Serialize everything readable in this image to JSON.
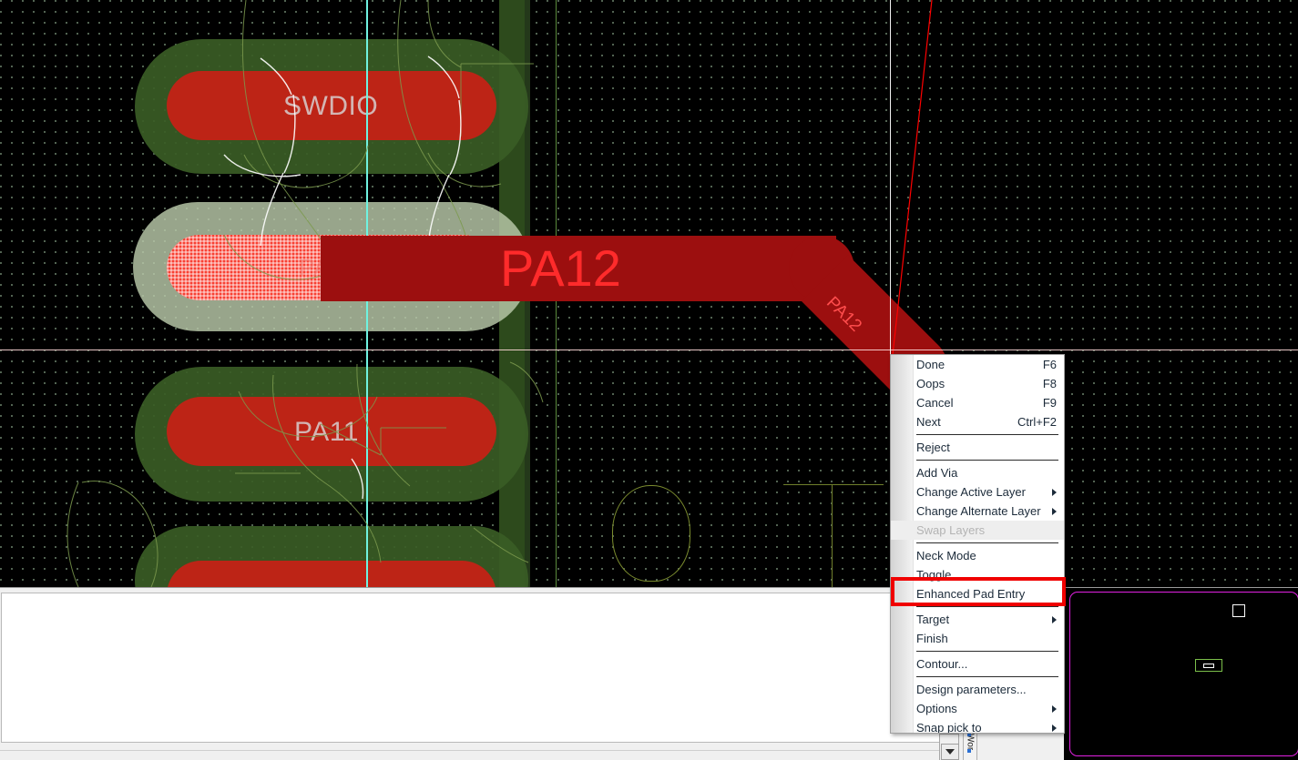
{
  "app": {
    "kind": "pcb-layout-editor",
    "colors": {
      "canvas_background": "#000000",
      "pad_copper": "#bd2416",
      "pad_copper_highlight": "#f84033",
      "soldermask_green": "#3a5c25",
      "soldermask_green_lit": "#b9c9a9",
      "trace_red": "#9c0f0f",
      "trace_label": "#ff2b2b",
      "crosshair_vertical": "#ffffff",
      "crosshair_horizontal": "#ffd9d9",
      "snap_line_cyan": "#6ff2e0",
      "silkscreen_olive": "#7a8b2e",
      "board_outline_magenta": "#e221e2",
      "annotation_red": "#f00000",
      "menu_background": "#ffffff",
      "menu_text": "#1c2b3a",
      "menu_disabled_text": "#b4b4b4"
    }
  },
  "canvas": {
    "pads": [
      {
        "name": "SWDIO",
        "label": "SWDIO",
        "state": "normal"
      },
      {
        "name": "PA12",
        "label": "PA12",
        "state": "highlighted"
      },
      {
        "name": "PA11",
        "label": "PA11",
        "state": "normal"
      },
      {
        "name": "pad-bottom",
        "label": "",
        "state": "normal"
      }
    ],
    "trace": {
      "net": "PA12",
      "label": "PA12",
      "rotated_label": "PA12"
    }
  },
  "context_menu": {
    "name": "route-context-menu",
    "items": [
      {
        "label": "Done",
        "accel": "F6",
        "type": "item",
        "enabled": true,
        "submenu": false
      },
      {
        "label": "Oops",
        "accel": "F8",
        "type": "item",
        "enabled": true,
        "submenu": false
      },
      {
        "label": "Cancel",
        "accel": "F9",
        "type": "item",
        "enabled": true,
        "submenu": false
      },
      {
        "label": "Next",
        "accel": "Ctrl+F2",
        "type": "item",
        "enabled": true,
        "submenu": false
      },
      {
        "label": "",
        "accel": "",
        "type": "separator",
        "enabled": true,
        "submenu": false
      },
      {
        "label": "Reject",
        "accel": "",
        "type": "item",
        "enabled": true,
        "submenu": false
      },
      {
        "label": "",
        "accel": "",
        "type": "separator",
        "enabled": true,
        "submenu": false
      },
      {
        "label": "Add Via",
        "accel": "",
        "type": "item",
        "enabled": true,
        "submenu": false
      },
      {
        "label": "Change Active Layer",
        "accel": "",
        "type": "item",
        "enabled": true,
        "submenu": true
      },
      {
        "label": "Change Alternate Layer",
        "accel": "",
        "type": "item",
        "enabled": true,
        "submenu": true
      },
      {
        "label": "Swap Layers",
        "accel": "",
        "type": "item",
        "enabled": false,
        "submenu": false
      },
      {
        "label": "",
        "accel": "",
        "type": "separator",
        "enabled": true,
        "submenu": false
      },
      {
        "label": "Neck Mode",
        "accel": "",
        "type": "item",
        "enabled": true,
        "submenu": false
      },
      {
        "label": "Toggle",
        "accel": "",
        "type": "item",
        "enabled": true,
        "submenu": false
      },
      {
        "label": "Enhanced Pad Entry",
        "accel": "",
        "type": "item",
        "enabled": true,
        "submenu": false
      },
      {
        "label": "",
        "accel": "",
        "type": "separator",
        "enabled": true,
        "submenu": false
      },
      {
        "label": "Target",
        "accel": "",
        "type": "item",
        "enabled": true,
        "submenu": true
      },
      {
        "label": "Finish",
        "accel": "",
        "type": "item",
        "enabled": true,
        "submenu": false
      },
      {
        "label": "",
        "accel": "",
        "type": "separator",
        "enabled": true,
        "submenu": false
      },
      {
        "label": "Contour...",
        "accel": "",
        "type": "item",
        "enabled": true,
        "submenu": false
      },
      {
        "label": "",
        "accel": "",
        "type": "separator",
        "enabled": true,
        "submenu": false
      },
      {
        "label": "Design parameters...",
        "accel": "",
        "type": "item",
        "enabled": true,
        "submenu": false
      },
      {
        "label": "Options",
        "accel": "",
        "type": "item",
        "enabled": true,
        "submenu": true
      },
      {
        "label": "Snap pick to",
        "accel": "",
        "type": "item",
        "enabled": true,
        "submenu": true
      }
    ],
    "highlighted_item": "Enhanced Pad Entry"
  },
  "bottom_dock": {
    "tab_label": "Wor",
    "scroll_down_icon": "chevron-down-icon"
  }
}
